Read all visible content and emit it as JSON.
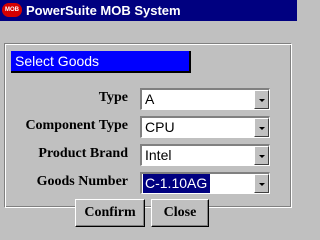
{
  "window": {
    "title": "PowerSuite MOB System",
    "icon_name": "app-logo-icon",
    "icon_text": "MOB",
    "titlebar_color": "#000080",
    "icon_color": "#D40000"
  },
  "section": {
    "title": "Select Goods",
    "header_color": "#0000FF"
  },
  "fields": [
    {
      "label": "Type",
      "value": "A"
    },
    {
      "label": "Component Type",
      "value": "CPU"
    },
    {
      "label": "Product Brand",
      "value": "Intel"
    },
    {
      "label": "Goods Number",
      "value": "C-1.10AG",
      "selected": true
    }
  ],
  "buttons": {
    "confirm_label": "Confirm",
    "close_label": "Close"
  },
  "colors": {
    "face": "#C0C0C0",
    "selection": "#000080"
  }
}
